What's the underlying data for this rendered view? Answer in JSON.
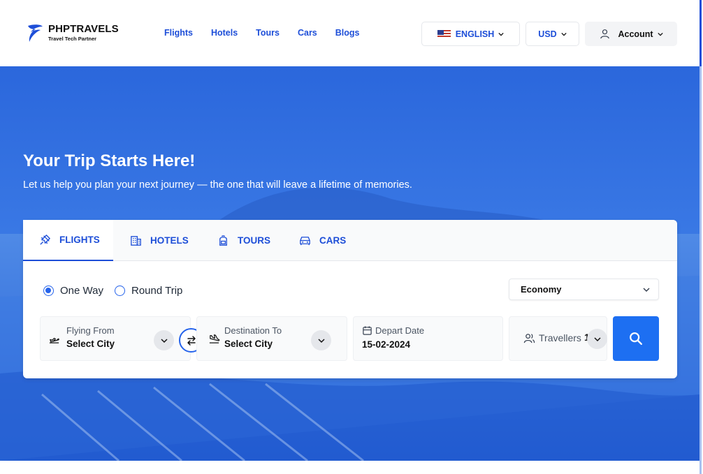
{
  "brand": {
    "name": "PHPTRAVELS",
    "tagline": "Travel Tech Partner"
  },
  "nav": [
    "Flights",
    "Hotels",
    "Tours",
    "Cars",
    "Blogs"
  ],
  "header": {
    "language": "ENGLISH",
    "currency": "USD",
    "account": "Account"
  },
  "hero": {
    "title": "Your Trip Starts Here!",
    "subtitle": "Let us help you plan your next journey — the one that will leave a lifetime of memories."
  },
  "search": {
    "tabs": [
      "FLIGHTS",
      "HOTELS",
      "TOURS",
      "CARS"
    ],
    "active_tab": "FLIGHTS",
    "trip_types": [
      "One Way",
      "Round Trip"
    ],
    "selected_trip_type": "One Way",
    "cabin_class": "Economy",
    "from": {
      "label": "Flying From",
      "value": "Select City"
    },
    "to": {
      "label": "Destination To",
      "value": "Select City"
    },
    "depart": {
      "label": "Depart Date",
      "value": "15-02-2024"
    },
    "travellers": {
      "label": "Travellers",
      "value": "1"
    }
  },
  "colors": {
    "accent": "#1d4ed8",
    "button": "#1d6ff2",
    "hero": "#2563eb"
  }
}
